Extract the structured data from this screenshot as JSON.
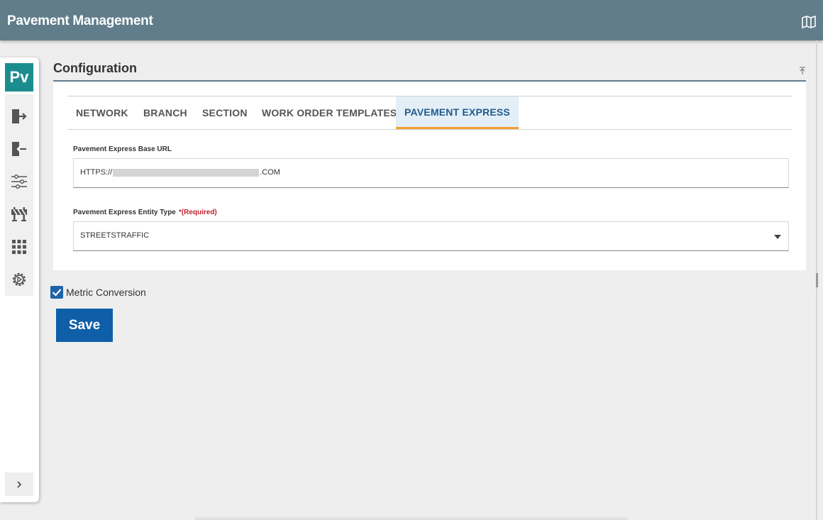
{
  "header": {
    "title": "Pavement Management",
    "map_icon": "map-icon"
  },
  "sidebar": {
    "badge": "Pv",
    "icons": [
      "sign-out-icon",
      "sign-in-icon",
      "sliders-icon",
      "barrier-icon",
      "apps-grid-icon",
      "settings-gear-icon"
    ],
    "expand_icon": "chevron-right-icon"
  },
  "config": {
    "title": "Configuration",
    "collapse_icon": "collapse-top-icon"
  },
  "tabs": [
    {
      "label": "NETWORK",
      "active": false
    },
    {
      "label": "BRANCH",
      "active": false
    },
    {
      "label": "SECTION",
      "active": false
    },
    {
      "label": "WORK ORDER TEMPLATES",
      "active": false
    },
    {
      "label": "PAVEMENT EXPRESS",
      "active": true
    }
  ],
  "fields": {
    "base_url": {
      "label": "Pavement Express Base URL",
      "value_prefix": "HTTPS://",
      "value_suffix": ".COM"
    },
    "entity_type": {
      "label": "Pavement Express Entity Type",
      "required": "*(Required)",
      "value": "STREETSTRAFFIC"
    }
  },
  "metric_conversion": {
    "label": "Metric Conversion",
    "checked": true
  },
  "actions": {
    "save_label": "Save"
  },
  "colors": {
    "header": "#617d8b",
    "badge": "#1b8d8f",
    "primary": "#0e5fa8",
    "active_tab_text": "#1f5b8e",
    "active_tab_underline": "#f0a030",
    "required": "#c0262d"
  }
}
